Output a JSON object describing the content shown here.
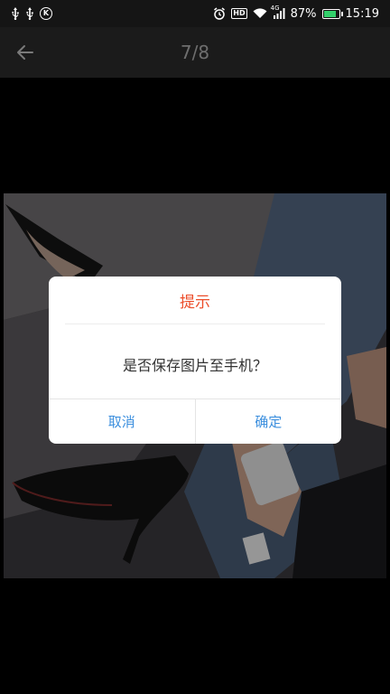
{
  "status_bar": {
    "left_icons": [
      "usb-icon",
      "usb-icon",
      "k-icon"
    ],
    "right_icons": [
      "alarm-icon",
      "hd-icon",
      "wifi-icon",
      "signal-icon"
    ],
    "network_label": "4G",
    "battery_percent": "87%",
    "battery_level": 0.87,
    "time": "15:19",
    "battery_color": "#33d06b"
  },
  "title_bar": {
    "back_icon": "back-arrow-icon",
    "page_indicator": "7/8"
  },
  "dialog": {
    "title": "提示",
    "message": "是否保存图片至手机？",
    "cancel_label": "取消",
    "confirm_label": "确定",
    "title_color": "#ec4d2a",
    "button_color": "#3c8fde"
  }
}
